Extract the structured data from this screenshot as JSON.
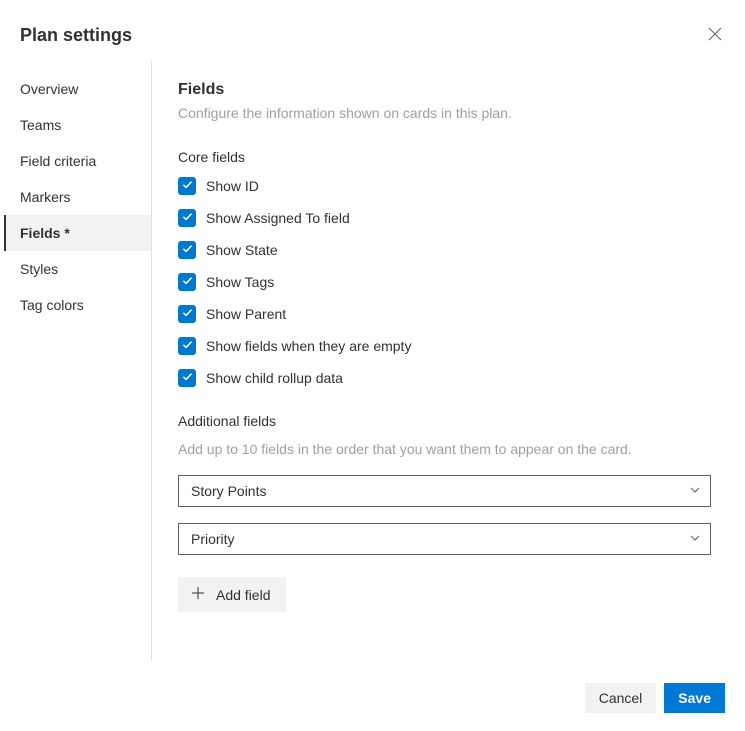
{
  "header": {
    "title": "Plan settings"
  },
  "sidebar": {
    "items": [
      {
        "label": "Overview"
      },
      {
        "label": "Teams"
      },
      {
        "label": "Field criteria"
      },
      {
        "label": "Markers"
      },
      {
        "label": "Fields *"
      },
      {
        "label": "Styles"
      },
      {
        "label": "Tag colors"
      }
    ]
  },
  "main": {
    "section_title": "Fields",
    "section_desc": "Configure the information shown on cards in this plan.",
    "core_fields_label": "Core fields",
    "core_fields": [
      {
        "label": "Show ID",
        "checked": true
      },
      {
        "label": "Show Assigned To field",
        "checked": true
      },
      {
        "label": "Show State",
        "checked": true
      },
      {
        "label": "Show Tags",
        "checked": true
      },
      {
        "label": "Show Parent",
        "checked": true
      },
      {
        "label": "Show fields when they are empty",
        "checked": true
      },
      {
        "label": "Show child rollup data",
        "checked": true
      }
    ],
    "additional_label": "Additional fields",
    "additional_desc": "Add up to 10 fields in the order that you want them to appear on the card.",
    "additional_fields": [
      {
        "value": "Story Points"
      },
      {
        "value": "Priority"
      }
    ],
    "add_field_label": "Add field"
  },
  "footer": {
    "cancel": "Cancel",
    "save": "Save"
  }
}
